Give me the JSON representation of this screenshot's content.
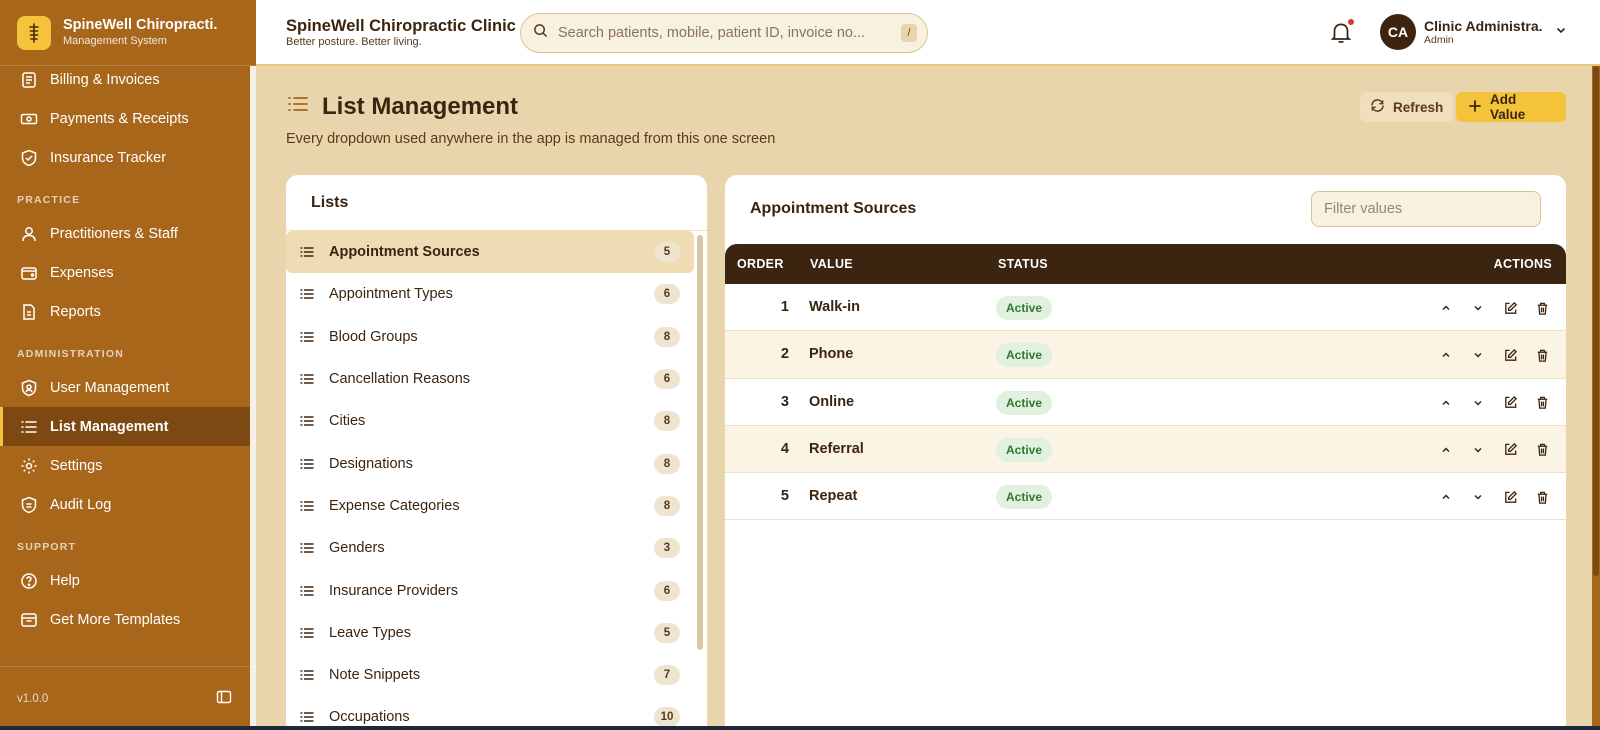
{
  "brand": {
    "name": "SpineWell Chiropracti.",
    "subtitle": "Management System"
  },
  "sidebar": {
    "items": [
      {
        "label": "Billing & Invoices",
        "icon": "invoice-icon"
      },
      {
        "label": "Payments & Receipts",
        "icon": "cash-icon"
      },
      {
        "label": "Insurance Tracker",
        "icon": "shield-check-icon"
      }
    ],
    "section_practice": "PRACTICE",
    "practice_items": [
      {
        "label": "Practitioners & Staff",
        "icon": "user-icon"
      },
      {
        "label": "Expenses",
        "icon": "wallet-icon"
      },
      {
        "label": "Reports",
        "icon": "report-icon"
      }
    ],
    "section_admin": "ADMINISTRATION",
    "admin_items": [
      {
        "label": "User Management",
        "icon": "user-shield-icon"
      },
      {
        "label": "List Management",
        "icon": "list-icon",
        "active": true
      },
      {
        "label": "Settings",
        "icon": "gear-icon"
      },
      {
        "label": "Audit Log",
        "icon": "shield-icon"
      }
    ],
    "section_support": "SUPPORT",
    "support_items": [
      {
        "label": "Help",
        "icon": "help-icon"
      },
      {
        "label": "Get More Templates",
        "icon": "store-icon"
      }
    ],
    "version": "v1.0.0"
  },
  "header": {
    "clinic_name": "SpineWell Chiropractic Clinic",
    "tagline": "Better posture. Better living.",
    "search_placeholder": "Search patients, mobile, patient ID, invoice no...",
    "search_shortcut": "/",
    "user_initials": "CA",
    "user_name": "Clinic Administra.",
    "user_role": "Admin"
  },
  "page": {
    "title": "List Management",
    "subtitle": "Every dropdown used anywhere in the app is managed from this one screen",
    "refresh_label": "Refresh",
    "add_label": "Add Value"
  },
  "lists": {
    "heading": "Lists",
    "items": [
      {
        "label": "Appointment Sources",
        "count": "5"
      },
      {
        "label": "Appointment Types",
        "count": "6"
      },
      {
        "label": "Blood Groups",
        "count": "8"
      },
      {
        "label": "Cancellation Reasons",
        "count": "6"
      },
      {
        "label": "Cities",
        "count": "8"
      },
      {
        "label": "Designations",
        "count": "8"
      },
      {
        "label": "Expense Categories",
        "count": "8"
      },
      {
        "label": "Genders",
        "count": "3"
      },
      {
        "label": "Insurance Providers",
        "count": "6"
      },
      {
        "label": "Leave Types",
        "count": "5"
      },
      {
        "label": "Note Snippets",
        "count": "7"
      },
      {
        "label": "Occupations",
        "count": "10"
      }
    ]
  },
  "values": {
    "title": "Appointment Sources",
    "filter_placeholder": "Filter values",
    "columns": {
      "order": "ORDER",
      "value": "VALUE",
      "status": "STATUS",
      "actions": "ACTIONS"
    },
    "rows": [
      {
        "order": "1",
        "value": "Walk-in",
        "status": "Active"
      },
      {
        "order": "2",
        "value": "Phone",
        "status": "Active"
      },
      {
        "order": "3",
        "value": "Online",
        "status": "Active"
      },
      {
        "order": "4",
        "value": "Referral",
        "status": "Active"
      },
      {
        "order": "5",
        "value": "Repeat",
        "status": "Active"
      }
    ]
  },
  "colors": {
    "sidebar": "#a8661b",
    "sidebar_active": "#7e4812",
    "page_bg": "#e9d5ab",
    "accent": "#f5c33a",
    "table_head": "#3b2410",
    "status_active": "#2f7a34"
  }
}
